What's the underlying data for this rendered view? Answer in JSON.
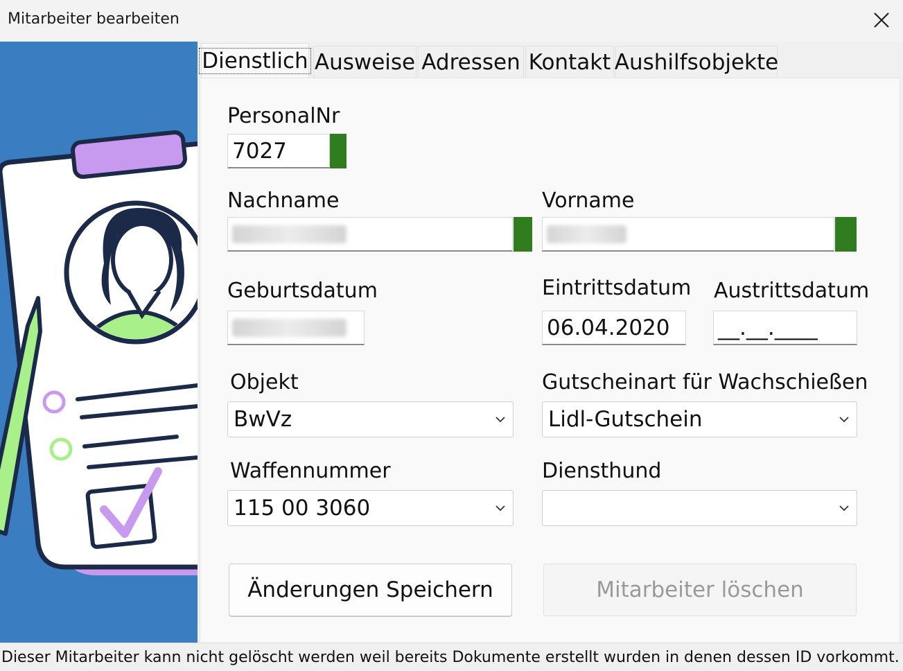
{
  "window": {
    "title": "Mitarbeiter bearbeiten"
  },
  "tabs": [
    {
      "label": "Dienstlich",
      "active": true
    },
    {
      "label": "Ausweise"
    },
    {
      "label": "Adressen"
    },
    {
      "label": "Kontakt"
    },
    {
      "label": "Aushilfsobjekte"
    }
  ],
  "form": {
    "personalnr": {
      "label": "PersonalNr",
      "value": "7027"
    },
    "nachname": {
      "label": "Nachname",
      "value": ""
    },
    "vorname": {
      "label": "Vorname",
      "value": ""
    },
    "geburtsdatum": {
      "label": "Geburtsdatum",
      "value": ""
    },
    "eintrittsdatum": {
      "label": "Eintrittsdatum",
      "value": "06.04.2020"
    },
    "austrittsdatum": {
      "label": "Austrittsdatum",
      "value": "__.__.____"
    },
    "objekt": {
      "label": "Objekt",
      "value": "BwVz"
    },
    "gutscheinart": {
      "label": "Gutscheinart für Wachschießen",
      "value": "Lidl-Gutschein"
    },
    "waffennummer": {
      "label": "Waffennummer",
      "value": "115 00 3060"
    },
    "diensthund": {
      "label": "Diensthund",
      "value": ""
    }
  },
  "buttons": {
    "save": "Änderungen Speichern",
    "delete": "Mitarbeiter löschen"
  },
  "status": {
    "text": "Dieser Mitarbeiter kann nicht gelöscht werden weil bereits Dokumente erstellt wurden in denen dessen ID vorkommt."
  },
  "colors": {
    "accent_green": "#2f7d1f",
    "illustration_bg": "#3a7dc0",
    "purple": "#c79af0",
    "light_green": "#a8f08a",
    "navy": "#1c2a4a"
  },
  "icons": {
    "close": "close-icon",
    "dropdown": "chevron-down-icon"
  }
}
